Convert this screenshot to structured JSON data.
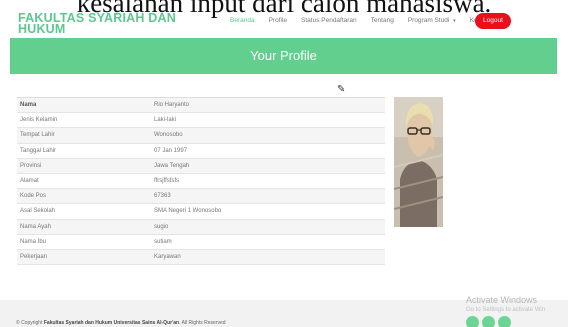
{
  "caption": "kesalahan input dari calon mahasiswa.",
  "brand": {
    "line1": "FAKULTAS SYARIAH DAN",
    "line2": "HUKUM"
  },
  "nav": {
    "items": [
      "Beranda",
      "Profile",
      "Status Pendaftaran",
      "Tentang",
      "Program Studi",
      "Kontak"
    ],
    "active": "Beranda",
    "logout": "Logout"
  },
  "banner": {
    "title": "Your Profile"
  },
  "profile": {
    "rows": [
      {
        "label": "Nama",
        "value": "Rio Haryanto"
      },
      {
        "label": "Jenis Kelamin",
        "value": "Laki-laki"
      },
      {
        "label": "Tempat Lahir",
        "value": "Wonosobo"
      },
      {
        "label": "Tanggal Lahir",
        "value": "07 Jan 1997"
      },
      {
        "label": "Provinsi",
        "value": "Jawa Tengah"
      },
      {
        "label": "Alamat",
        "value": "ffrsjffsfsfs"
      },
      {
        "label": "Kode Pos",
        "value": "67363"
      },
      {
        "label": "Asal Sekolah",
        "value": "SMA Negeri 1 Wonosobo"
      },
      {
        "label": "Nama Ayah",
        "value": "sugio"
      },
      {
        "label": "Nama Ibu",
        "value": "sutiam"
      },
      {
        "label": "Pekerjaan",
        "value": "Karyawan"
      }
    ]
  },
  "footer": {
    "copyright_prefix": "© Copyright ",
    "copyright_org": "Fakultas Syariah dan Hukum Universitas Sains Al-Qur'an",
    "copyright_suffix": ". All Rights Reserved",
    "watermark_title": "Activate Windows",
    "watermark_sub": "Go to Settings to activate Win",
    "social_icons": [
      "twitter-icon",
      "facebook-icon",
      "instagram-icon"
    ]
  },
  "colors": {
    "accent": "#63cf8e",
    "brand": "#5bc890",
    "logout": "#e8101b"
  }
}
